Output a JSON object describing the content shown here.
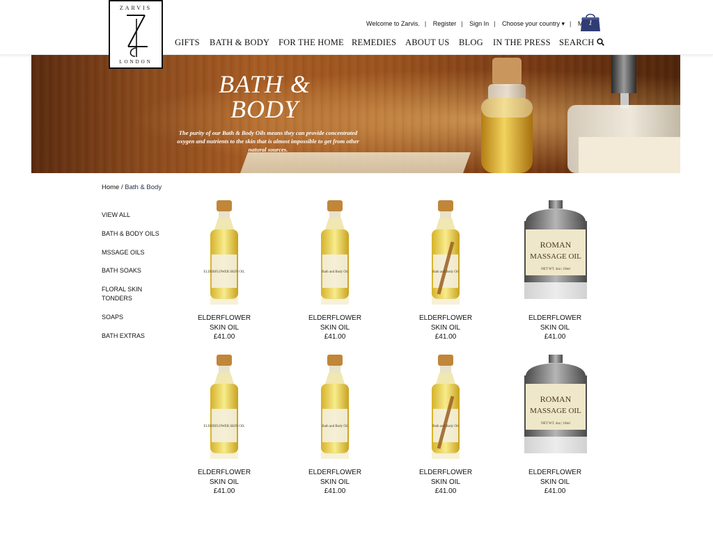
{
  "brand": {
    "top": "ZARVIS",
    "bottom": "LONDON",
    "monogram": "ZL"
  },
  "toplinks": {
    "welcome": "Welcome to Zarvis.",
    "register": "Register",
    "sign_in": "Sign In",
    "country": "Choose your country ▾",
    "bag": "My Bag",
    "bag_count": "1"
  },
  "nav": [
    "GIFTS",
    "BATH & BODY",
    "FOR THE HOME",
    "REMEDIES",
    "ABOUT US",
    "BLOG",
    "IN THE PRESS",
    "SEARCH"
  ],
  "banner": {
    "title_line1": "BATH &",
    "title_line2": "BODY",
    "text": "The purity of our Bath & Body Oils means they can provide concentrated oxygen and nutrients to the skin that is almost impossible to get from other natural sources."
  },
  "breadcrumb": {
    "home": "Home",
    "sep": " / ",
    "current": "Bath & Body"
  },
  "sidebar": [
    "VIEW ALL",
    "BATH & BODY OILS",
    "MSSAGE OILS",
    "BATH SOAKS",
    "FLORAL SKIN TONDERS",
    "SOAPS",
    "BATH EXTRAS"
  ],
  "products": [
    {
      "name": "ELDERFLOWER SKIN OIL",
      "price": "£41.00",
      "image": "elderflower-bottle",
      "label": "ELDERFLOWER SKIN OIL"
    },
    {
      "name": "ELDERFLOWER SKIN OIL",
      "price": "£41.00",
      "image": "bath-body-oil-bottle",
      "label": "Bath and Body Oil"
    },
    {
      "name": "ELDERFLOWER SKIN OIL",
      "price": "£41.00",
      "image": "bath-body-oil-botanical-bottle",
      "label": "Bath and Body Oil"
    },
    {
      "name": "ELDERFLOWER SKIN OIL",
      "price": "£41.00",
      "image": "massage-oil-tin",
      "label": "ROMAN MASSAGE OIL",
      "sublabel": "NET WT. 4oz | 10ml"
    },
    {
      "name": "ELDERFLOWER SKIN OIL",
      "price": "£41.00",
      "image": "elderflower-bottle",
      "label": "ELDERFLOWER SKIN OIL"
    },
    {
      "name": "ELDERFLOWER SKIN OIL",
      "price": "£41.00",
      "image": "bath-body-oil-bottle",
      "label": "Bath and Body Oil"
    },
    {
      "name": "ELDERFLOWER SKIN OIL",
      "price": "£41.00",
      "image": "bath-body-oil-botanical-bottle",
      "label": "Bath and Body Oil"
    },
    {
      "name": "ELDERFLOWER SKIN OIL",
      "price": "£41.00",
      "image": "massage-oil-tin",
      "label": "ROMAN MASSAGE OIL",
      "sublabel": "NET WT. 4oz | 10ml"
    }
  ],
  "colors": {
    "bag": "#2f3d73",
    "breadcrumb_current": "#23344e",
    "oil": "#e8c93a",
    "cork": "#c0863a"
  }
}
